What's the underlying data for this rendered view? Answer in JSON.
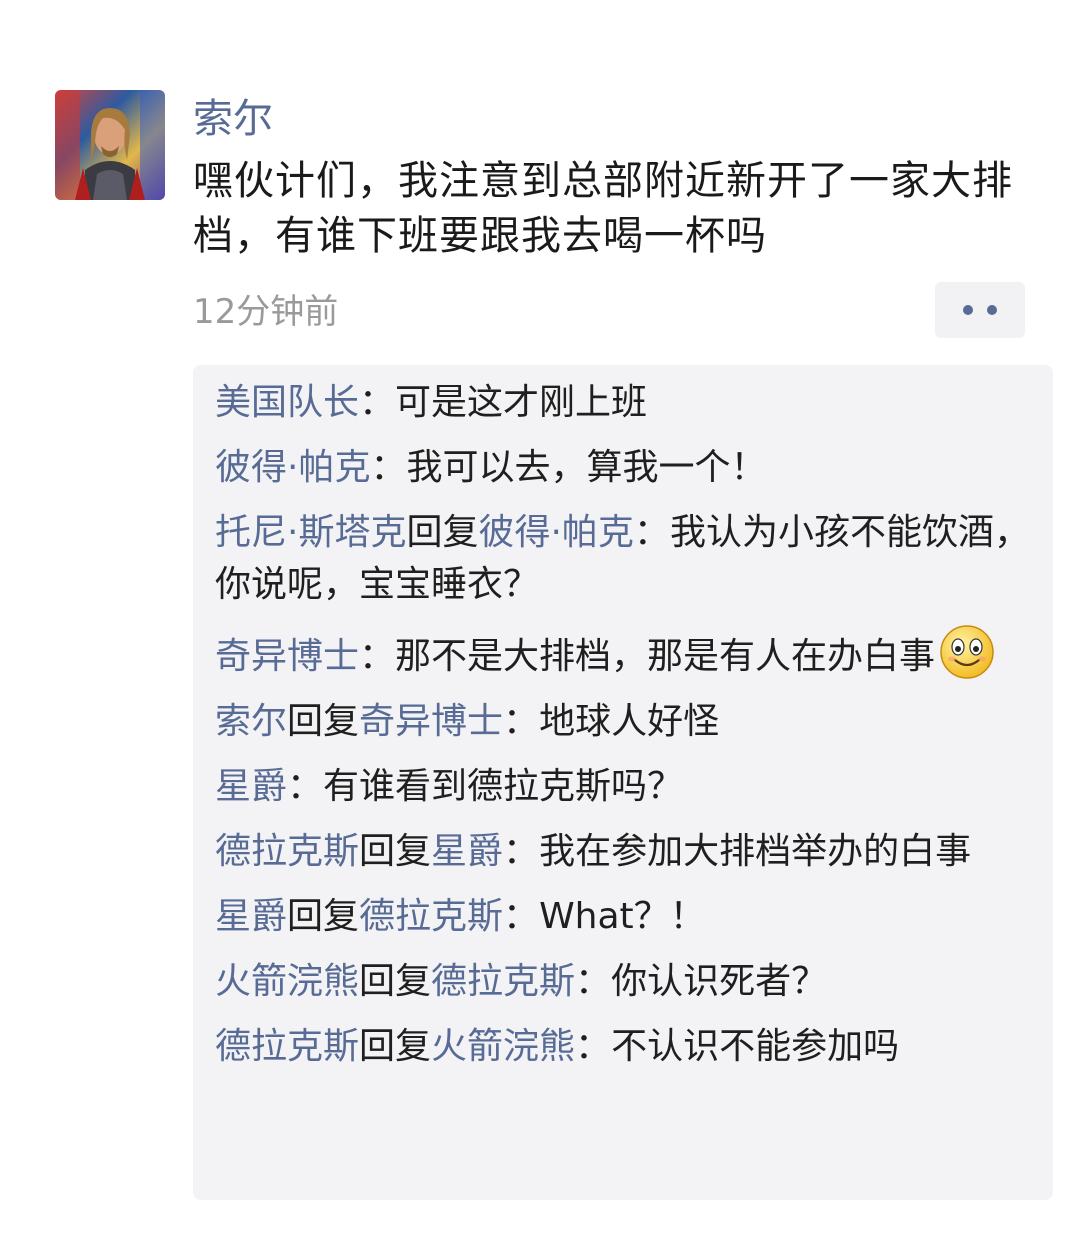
{
  "post": {
    "author": "索尔",
    "text": "嘿伙计们，我注意到总部附近新开了一家大排档，有谁下班要跟我去喝一杯吗",
    "timestamp": "12分钟前"
  },
  "colors": {
    "name_link": "#576b95",
    "body_text": "#1a1a1a",
    "meta_text": "#9a9a9a",
    "comment_bg": "#f3f3f5"
  },
  "comments": [
    {
      "from": "美国队长",
      "reply_word": "",
      "to": "",
      "text": "可是这才刚上班"
    },
    {
      "from": "彼得·帕克",
      "reply_word": "",
      "to": "",
      "text": "我可以去，算我一个！"
    },
    {
      "from": "托尼·斯塔克",
      "reply_word": "回复",
      "to": "彼得·帕克",
      "text": "我认为小孩不能饮酒，你说呢，宝宝睡衣？"
    },
    {
      "from": "奇异博士",
      "reply_word": "",
      "to": "",
      "text": "那不是大排档，那是有人在办白事"
    },
    {
      "from": "索尔",
      "reply_word": "回复",
      "to": "奇异博士",
      "text": "地球人好怪"
    },
    {
      "from": "星爵",
      "reply_word": "",
      "to": "",
      "text": "有谁看到德拉克斯吗？"
    },
    {
      "from": "德拉克斯",
      "reply_word": "回复",
      "to": "星爵",
      "text": "我在参加大排档举办的白事"
    },
    {
      "from": "星爵",
      "reply_word": "回复",
      "to": "德拉克斯",
      "text": "What？！"
    },
    {
      "from": "火箭浣熊",
      "reply_word": "回复",
      "to": "德拉克斯",
      "text": "你认识死者？"
    },
    {
      "from": "德拉克斯",
      "reply_word": "回复",
      "to": "火箭浣熊",
      "text": "不认识不能参加吗"
    }
  ],
  "colon": "："
}
